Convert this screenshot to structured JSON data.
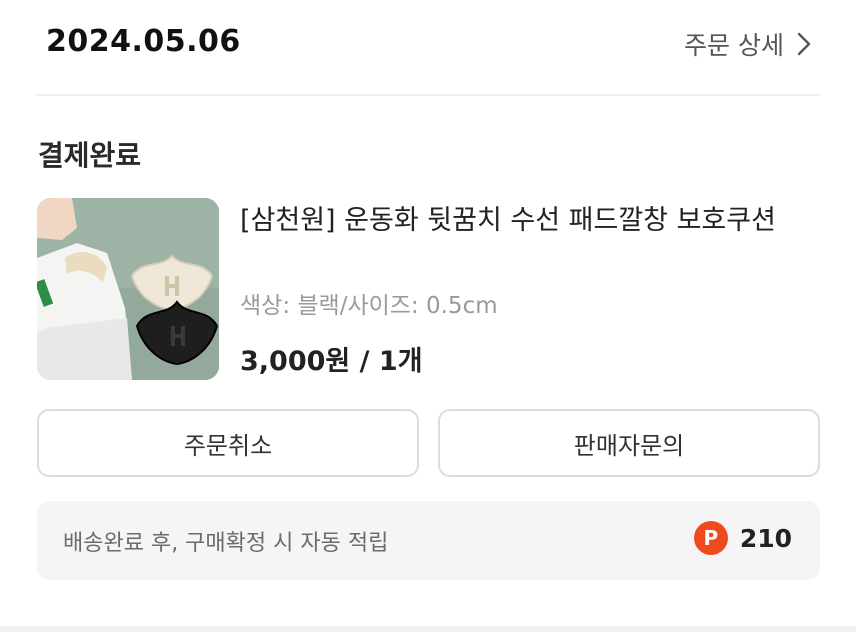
{
  "order": {
    "date": "2024.05.06",
    "detail_link": "주문 상세",
    "status": "결제완료"
  },
  "product": {
    "name": "[삼천원] 운동화 뒷꿈치 수선 패드깔창 보호쿠션",
    "options": "색상: 블랙/사이즈: 0.5cm",
    "price": "3,000원 / 1개"
  },
  "actions": {
    "cancel_label": "주문취소",
    "inquiry_label": "판매자문의"
  },
  "points": {
    "description": "배송완료 후, 구매확정 시 자동 적립",
    "icon_letter": "P",
    "value": "210",
    "icon_color": "#ee4a1d"
  }
}
